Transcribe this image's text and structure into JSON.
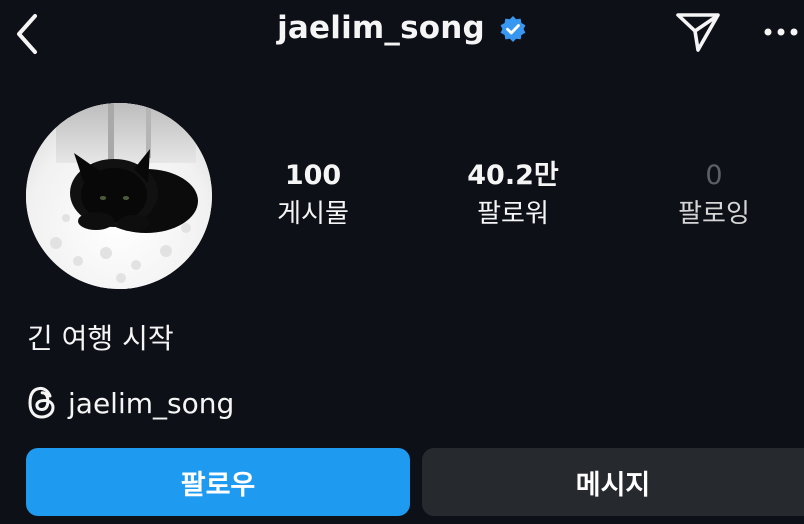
{
  "header": {
    "username": "jaelim_song",
    "back_icon": "chevron-left-icon",
    "verified_icon": "verified-badge-icon",
    "send_icon": "paper-plane-icon",
    "more_icon": "more-horizontal-icon"
  },
  "profile": {
    "avatar_description": "black cat on white blanket",
    "stats": [
      {
        "value": "100",
        "label": "게시물"
      },
      {
        "value": "40.2만",
        "label": "팔로워"
      },
      {
        "value": "0",
        "label": "팔로잉"
      }
    ],
    "bio": "긴 여행 시작",
    "threads_handle": "jaelim_song",
    "threads_icon": "threads-icon"
  },
  "actions": {
    "follow_label": "팔로우",
    "message_label": "메시지"
  },
  "colors": {
    "background": "#0d1117",
    "follow_button": "#1e9bf0",
    "message_button": "#262a2f",
    "verified": "#3897f0"
  }
}
